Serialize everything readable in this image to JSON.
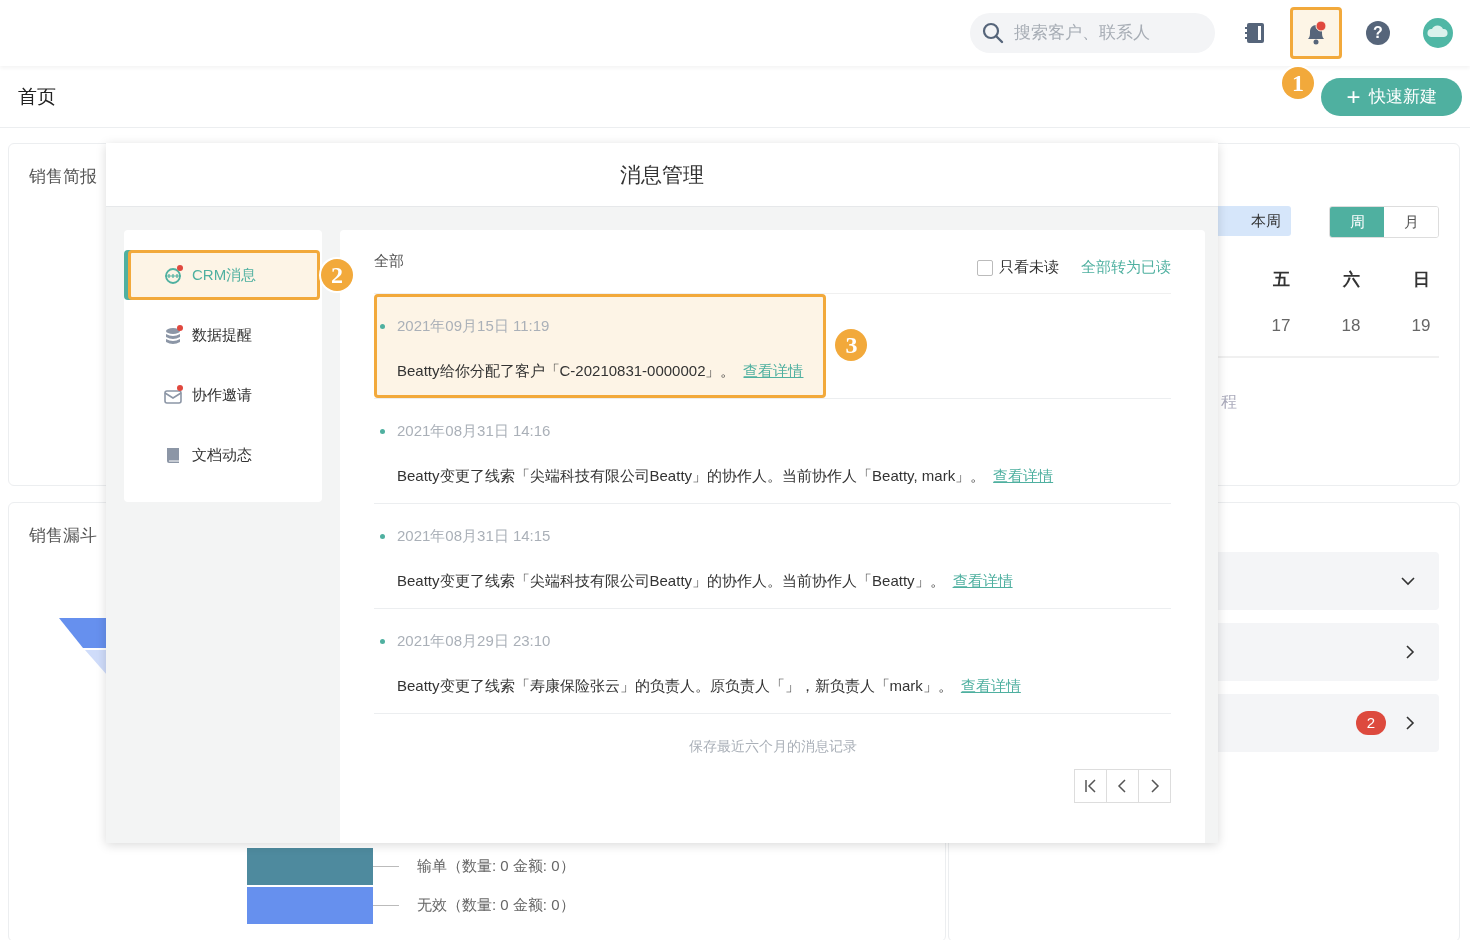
{
  "header": {
    "search": {
      "placeholder": "搜索客户、联系人"
    },
    "notifications": {
      "unread": true,
      "highlighted": true,
      "callout": "1"
    },
    "help": "?"
  },
  "page": {
    "title": "首页",
    "quick_create": {
      "icon": "+",
      "label": "快速新建"
    }
  },
  "sales_brief": {
    "title": "销售简报"
  },
  "sales_funnel": {
    "title": "销售漏斗",
    "stages": [
      {
        "label": "输单（数量: 0 金额: 0）",
        "color": "#4e8a9e"
      },
      {
        "label": "无效（数量: 0 金额: 0）",
        "color": "#6690ee"
      }
    ]
  },
  "calendar": {
    "range_button": "本周",
    "views": [
      {
        "label": "周",
        "selected": true
      },
      {
        "label": "月",
        "selected": false
      }
    ],
    "weekdays": [
      "五",
      "六",
      "日"
    ],
    "dates": [
      "17",
      "18",
      "19"
    ],
    "empty_text": "程"
  },
  "tasks": [
    {
      "expanded": true
    },
    {
      "expanded": false
    },
    {
      "expanded": false,
      "badge": "2"
    }
  ],
  "modal": {
    "title": "消息管理",
    "categories": [
      {
        "label": "CRM消息",
        "kind": "crm",
        "unread": true,
        "selected": true,
        "highlighted": true,
        "callout": "2"
      },
      {
        "label": "数据提醒",
        "kind": "data",
        "unread": true,
        "selected": false,
        "highlighted": false
      },
      {
        "label": "协作邀请",
        "kind": "invite",
        "unread": true,
        "selected": false,
        "highlighted": false
      },
      {
        "label": "文档动态",
        "kind": "docs",
        "unread": false,
        "selected": false,
        "highlighted": false
      }
    ],
    "filter_label": "全部",
    "unread_only": {
      "label": "只看未读",
      "checked": false
    },
    "mark_all_read": "全部转为已读",
    "messages": [
      {
        "time": "2021年09月15日 11:19",
        "text": "Beatty给你分配了客户「C-20210831-0000002」。",
        "link": "查看详情",
        "unread": true,
        "highlighted": true,
        "callout": "3"
      },
      {
        "time": "2021年08月31日 14:16",
        "text": "Beatty变更了线索「尖端科技有限公司Beatty」的协作人。当前协作人「Beatty, mark」。",
        "link": "查看详情",
        "unread": true,
        "highlighted": false
      },
      {
        "time": "2021年08月31日 14:15",
        "text": "Beatty变更了线索「尖端科技有限公司Beatty」的协作人。当前协作人「Beatty」。",
        "link": "查看详情",
        "unread": true,
        "highlighted": false
      },
      {
        "time": "2021年08月29日 23:10",
        "text": "Beatty变更了线索「寿康保险张云」的负责人。原负责人「」，新负责人「mark」。",
        "link": "查看详情",
        "unread": true,
        "highlighted": false
      }
    ],
    "footer": "保存最近六个月的消息记录"
  }
}
